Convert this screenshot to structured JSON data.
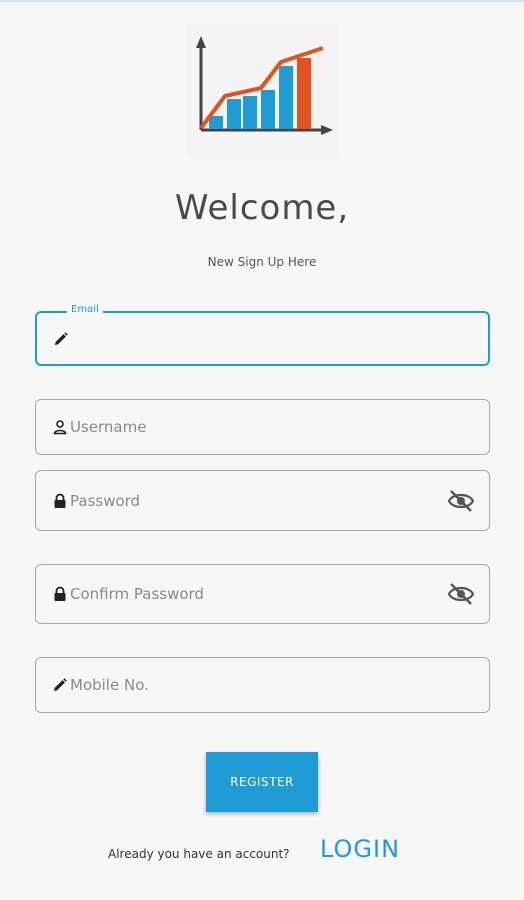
{
  "header": {
    "welcome": "Welcome,",
    "subtitle": "New Sign Up Here"
  },
  "form": {
    "email": {
      "label": "Email",
      "value": "",
      "icon": "pencil-icon"
    },
    "username": {
      "placeholder": "Username",
      "icon": "person-icon"
    },
    "password": {
      "placeholder": "Password",
      "icon": "lock-icon",
      "toggle_icon": "eye-off-icon"
    },
    "confirm_password": {
      "placeholder": "Confirm Password",
      "icon": "lock-icon",
      "toggle_icon": "eye-off-icon"
    },
    "mobile": {
      "placeholder": "Mobile No.",
      "icon": "pencil-icon"
    }
  },
  "actions": {
    "register_label": "REGISTER",
    "already_text": "Already you have an account?",
    "login_label": "LOGIN"
  },
  "colors": {
    "accent": "#1f9bd6",
    "logo_line": "#e0531f",
    "background": "#f7f7f7"
  }
}
